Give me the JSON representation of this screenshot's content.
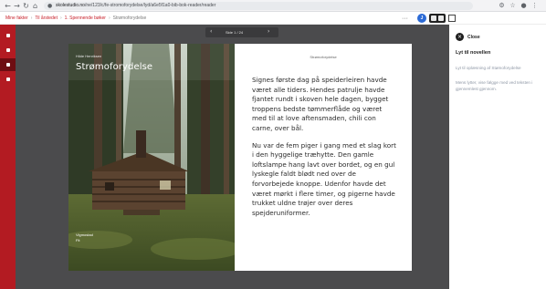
{
  "browser": {
    "back_icon": "arrow-left-icon",
    "forward_icon": "arrow-right-icon",
    "reload_icon": "reload-icon",
    "home_icon": "home-icon",
    "url_host": "skolestudio.no",
    "url_path": "/ne/123/c/fe-stromoforydelse/lyd/a6e5f1a0-bib-bok-reader/reader"
  },
  "appbar": {
    "breadcrumbs": [
      "Mine fakter",
      "Til årstedet",
      "1. Spennende bøker"
    ],
    "current": "Strømoforydelse",
    "more_label": "···",
    "avatar_initial": "J"
  },
  "pager": {
    "prev": "‹",
    "next": "›",
    "label": "Side 1 / 24"
  },
  "book": {
    "cover": {
      "author": "Hilde Henriksen",
      "title": "Strømoforydelse",
      "publisher_line1": "Vigmostad",
      "publisher_line2": "Fit"
    },
    "page": {
      "header": "Strømoforydelse",
      "paragraphs": [
        "Signes første dag på speiderleiren havde været alle tiders. Hendes patrulje havde fjantet rundt i skoven hele dagen, bygget troppens bedste tømmerflåde og været med til at love aftensmaden, chili con carne, over bål.",
        "Nu var de fem piger i gang med et slag kort i den hyggelige træhytte. Den gamle loftslampe hang lavt over bordet, og en gul lyskegle faldt blødt ned over de forvorbejede knoppe. Udenfor havde det været mørkt i flere timer, og pigerne havde trukket uldne trøjer over deres spejderuniformer."
      ]
    }
  },
  "panel": {
    "close_label": "Close",
    "close_icon": "close-icon",
    "title": "Lyt til novellen",
    "subtitle": "Lyt til oplæsning af Stømoforydelse",
    "note": "Mens lytter, vise følgge med ved teksten i gjennemlest gjennom."
  },
  "colors": {
    "brand_red": "#b31b22",
    "reader_bg": "#4b4b4d",
    "avatar_blue": "#2c6bd6"
  }
}
